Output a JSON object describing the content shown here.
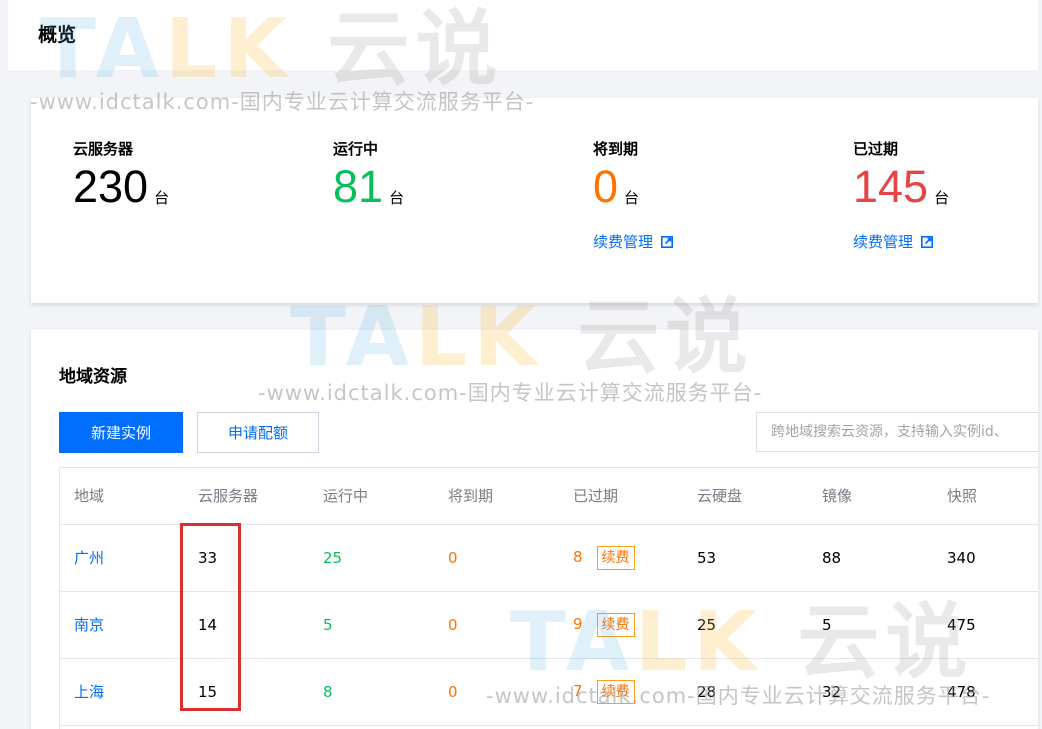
{
  "header": {
    "title": "概览"
  },
  "overview": {
    "stats": [
      {
        "label": "云服务器",
        "value": "230",
        "unit": "台",
        "color": "#000000"
      },
      {
        "label": "运行中",
        "value": "81",
        "unit": "台",
        "color": "#0abf5b"
      },
      {
        "label": "将到期",
        "value": "0",
        "unit": "台",
        "color": "#ff7200",
        "link": "续费管理"
      },
      {
        "label": "已过期",
        "value": "145",
        "unit": "台",
        "color": "#e54545",
        "link": "续费管理"
      }
    ]
  },
  "region": {
    "title": "地域资源",
    "create_button": "新建实例",
    "quota_button": "申请配额",
    "search_placeholder": "跨地域搜索云资源，支持输入实例id、",
    "columns": [
      "地域",
      "云服务器",
      "运行中",
      "将到期",
      "已过期",
      "云硬盘",
      "镜像",
      "快照"
    ],
    "renew_tag": "续费",
    "rows": [
      {
        "region": "广州",
        "servers": "33",
        "running": "25",
        "expiring": "0",
        "expired": "8",
        "disks": "53",
        "images": "88",
        "snapshots": "340"
      },
      {
        "region": "南京",
        "servers": "14",
        "running": "5",
        "expiring": "0",
        "expired": "9",
        "disks": "25",
        "images": "5",
        "snapshots": "475"
      },
      {
        "region": "上海",
        "servers": "15",
        "running": "8",
        "expiring": "0",
        "expired": "7",
        "disks": "28",
        "images": "32",
        "snapshots": "478"
      }
    ]
  },
  "watermark": {
    "text": "-www.idctalk.com-国内专业云计算交流服务平台-",
    "logo_a": "TA",
    "logo_b": "LK",
    "logo_c": "云说"
  },
  "colors": {
    "primary": "#006eff",
    "running": "#0abf5b",
    "warning": "#ff7200",
    "expired": "#e54545",
    "highlight": "#d9302f"
  }
}
